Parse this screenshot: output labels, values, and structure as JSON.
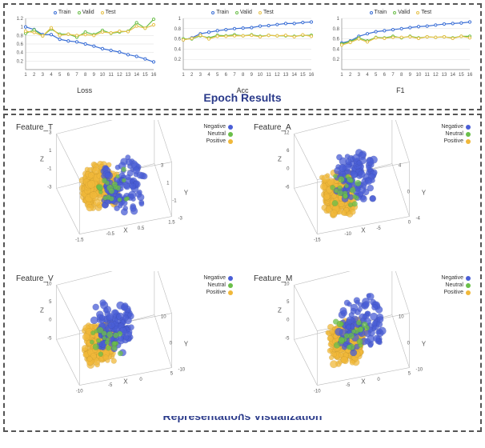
{
  "colors": {
    "train": "#3b6fd6",
    "valid": "#6bbf4a",
    "test": "#e6c24a",
    "negative": "#4a5ed6",
    "neutral": "#6bbf4a",
    "positive": "#f0b83a"
  },
  "section_titles": {
    "epoch": "Epoch Results",
    "rep": "Representations Visualization"
  },
  "legend_line": [
    "Train",
    "Valid",
    "Test"
  ],
  "legend_scatter": [
    "Negative",
    "Neutral",
    "Positive"
  ],
  "chart_data": [
    {
      "type": "line",
      "title": "Loss",
      "xlabel": "Loss",
      "x": [
        1,
        2,
        3,
        4,
        5,
        6,
        7,
        8,
        9,
        10,
        11,
        12,
        13,
        14,
        15,
        16
      ],
      "series": [
        {
          "name": "Train",
          "values": [
            1.0,
            0.94,
            0.82,
            0.82,
            0.71,
            0.67,
            0.65,
            0.6,
            0.55,
            0.49,
            0.45,
            0.41,
            0.35,
            0.31,
            0.25,
            0.18
          ]
        },
        {
          "name": "Valid",
          "values": [
            0.85,
            0.93,
            0.79,
            0.95,
            0.83,
            0.83,
            0.76,
            0.88,
            0.82,
            0.92,
            0.85,
            0.88,
            0.9,
            1.1,
            0.97,
            1.18
          ]
        },
        {
          "name": "Test",
          "values": [
            0.9,
            0.87,
            0.79,
            0.98,
            0.8,
            0.83,
            0.8,
            0.82,
            0.8,
            0.88,
            0.86,
            0.9,
            0.89,
            1.02,
            0.97,
            1.05
          ]
        }
      ],
      "ylim": [
        0,
        1.2
      ],
      "yticks": [
        0.2,
        0.4,
        0.6,
        0.8,
        1.0,
        1.2
      ]
    },
    {
      "type": "line",
      "title": "Acc",
      "xlabel": "Acc",
      "x": [
        1,
        2,
        3,
        4,
        5,
        6,
        7,
        8,
        9,
        10,
        11,
        12,
        13,
        14,
        15,
        16
      ],
      "series": [
        {
          "name": "Train",
          "values": [
            0.58,
            0.62,
            0.7,
            0.73,
            0.76,
            0.78,
            0.8,
            0.81,
            0.82,
            0.85,
            0.86,
            0.88,
            0.9,
            0.9,
            0.92,
            0.93
          ]
        },
        {
          "name": "Valid",
          "values": [
            0.6,
            0.6,
            0.66,
            0.62,
            0.67,
            0.66,
            0.68,
            0.66,
            0.68,
            0.65,
            0.67,
            0.66,
            0.66,
            0.65,
            0.67,
            0.67
          ]
        },
        {
          "name": "Test",
          "values": [
            0.58,
            0.61,
            0.67,
            0.6,
            0.65,
            0.65,
            0.66,
            0.66,
            0.67,
            0.64,
            0.67,
            0.66,
            0.67,
            0.64,
            0.68,
            0.65
          ]
        }
      ],
      "ylim": [
        0,
        1.0
      ],
      "yticks": [
        0.2,
        0.4,
        0.6,
        0.8,
        1.0
      ]
    },
    {
      "type": "line",
      "title": "F1",
      "xlabel": "F1",
      "x": [
        1,
        2,
        3,
        4,
        5,
        6,
        7,
        8,
        9,
        10,
        11,
        12,
        13,
        14,
        15,
        16
      ],
      "series": [
        {
          "name": "Train",
          "values": [
            0.52,
            0.56,
            0.65,
            0.7,
            0.74,
            0.76,
            0.78,
            0.8,
            0.82,
            0.84,
            0.85,
            0.87,
            0.89,
            0.9,
            0.91,
            0.93
          ]
        },
        {
          "name": "Valid",
          "values": [
            0.5,
            0.55,
            0.62,
            0.56,
            0.63,
            0.62,
            0.65,
            0.62,
            0.65,
            0.62,
            0.64,
            0.63,
            0.64,
            0.62,
            0.65,
            0.65
          ]
        },
        {
          "name": "Test",
          "values": [
            0.48,
            0.53,
            0.6,
            0.54,
            0.62,
            0.61,
            0.63,
            0.63,
            0.64,
            0.61,
            0.64,
            0.63,
            0.64,
            0.61,
            0.65,
            0.62
          ]
        }
      ],
      "ylim": [
        0,
        1.0
      ],
      "yticks": [
        0.2,
        0.4,
        0.6,
        0.8,
        1.0
      ]
    }
  ],
  "scatter_plots": [
    {
      "title": "Feature_T",
      "cluster": {
        "pos_center": [
          0.35,
          0.45
        ],
        "neg_center": [
          0.55,
          0.65
        ],
        "spread": 0.32
      },
      "axes": {
        "x": "X",
        "y": "Y",
        "z": "Z",
        "xticks": [
          "-1.5",
          "-0.5",
          "0.5",
          "1.5"
        ],
        "yticks": [
          "-3",
          "-1",
          "1",
          "3"
        ],
        "zticks": [
          "-3",
          "-1",
          "1",
          "3"
        ]
      }
    },
    {
      "title": "Feature_A",
      "cluster": {
        "pos_center": [
          0.32,
          0.6
        ],
        "neg_center": [
          0.55,
          0.42
        ],
        "spread": 0.3
      },
      "axes": {
        "x": "X",
        "y": "Y",
        "z": "Z",
        "xticks": [
          "-15",
          "-10",
          "-5",
          "0"
        ],
        "yticks": [
          "-4",
          "0",
          "4"
        ],
        "zticks": [
          "-6",
          "0",
          "6",
          "12"
        ]
      }
    },
    {
      "title": "Feature_V",
      "cluster": {
        "pos_center": [
          0.32,
          0.55
        ],
        "neg_center": [
          0.5,
          0.4
        ],
        "spread": 0.28
      },
      "axes": {
        "x": "X",
        "y": "Y",
        "z": "Z",
        "xticks": [
          "-10",
          "-5",
          "0",
          "5"
        ],
        "yticks": [
          "-10",
          "0",
          "10"
        ],
        "zticks": [
          "-5",
          "0",
          "5",
          "10"
        ]
      }
    },
    {
      "title": "Feature_M",
      "cluster": {
        "pos_center": [
          0.42,
          0.55
        ],
        "neg_center": [
          0.6,
          0.4
        ],
        "spread": 0.34
      },
      "axes": {
        "x": "X",
        "y": "Y",
        "z": "Z",
        "xticks": [
          "-10",
          "-5",
          "0",
          "5"
        ],
        "yticks": [
          "-10",
          "0",
          "10"
        ],
        "zticks": [
          "-5",
          "0",
          "5",
          "10"
        ]
      }
    }
  ]
}
